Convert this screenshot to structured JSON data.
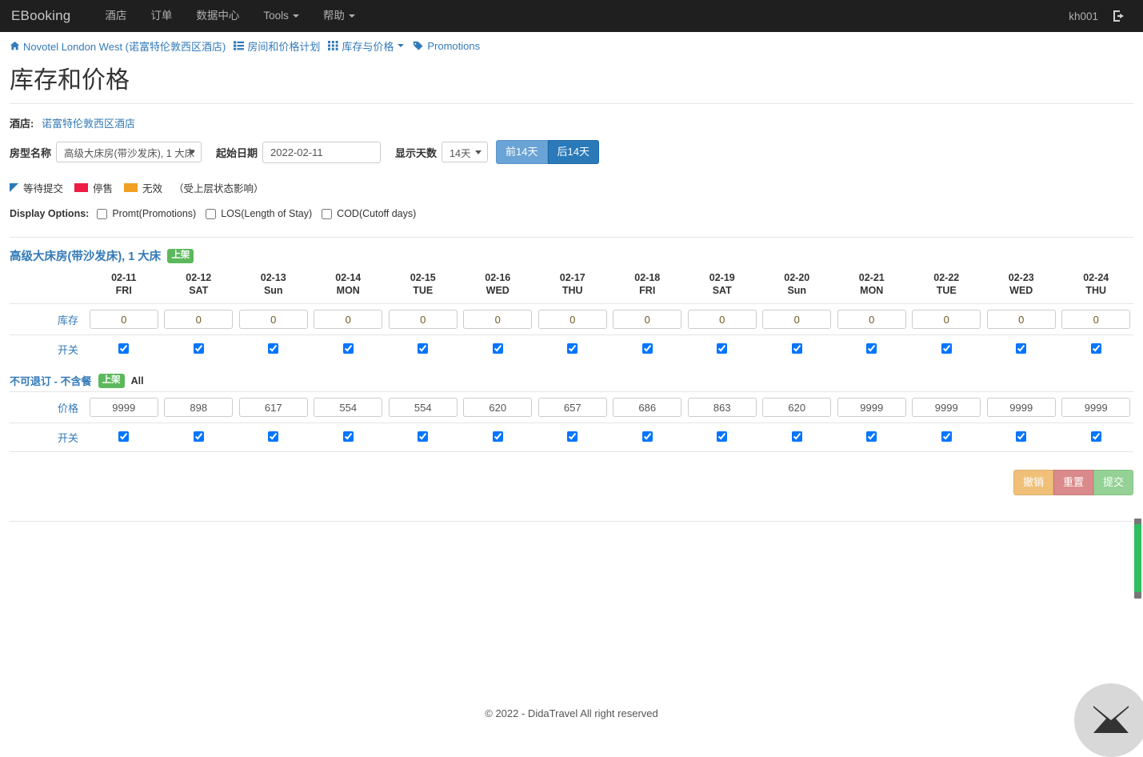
{
  "navbar": {
    "brand": "EBooking",
    "items": [
      {
        "label": "酒店",
        "caret": false
      },
      {
        "label": "订单",
        "caret": false
      },
      {
        "label": "数据中心",
        "caret": false
      },
      {
        "label": "Tools",
        "caret": true
      },
      {
        "label": "帮助",
        "caret": true
      }
    ],
    "user": "kh001",
    "logout_icon": "logout-icon"
  },
  "breadcrumb": {
    "home_icon": "home-icon",
    "hotel": "Novotel London West (诺富特伦敦西区酒店)",
    "list_icon": "list-icon",
    "rooms_plans": "房间和价格计划",
    "grid_icon": "grid-icon",
    "inventory_price": "库存与价格",
    "tag_icon": "tag-icon",
    "promotions": "Promotions"
  },
  "page": {
    "title": "库存和价格",
    "hotel_label": "酒店:",
    "hotel_name": "诺富特伦敦西区酒店"
  },
  "filters": {
    "roomtype_label": "房型名称",
    "roomtype_value": "高级大床房(带沙发床), 1 大床",
    "startdate_label": "起始日期",
    "startdate_value": "2022-02-11",
    "days_label": "显示天数",
    "days_value": "14天",
    "prev_btn": "前14天",
    "next_btn": "后14天"
  },
  "legend": {
    "pending": "等待提交",
    "stopsale": "停售",
    "invalid": "无效",
    "note": "（受上层状态影响）",
    "pending_color": "#2a7ab9",
    "stopsale_color": "#ec1c45",
    "invalid_color": "#f0a025"
  },
  "display_options": {
    "title": "Display Options:",
    "options": [
      {
        "label": "Promt(Promotions)",
        "checked": false
      },
      {
        "label": "LOS(Length of Stay)",
        "checked": false
      },
      {
        "label": "COD(Cutoff days)",
        "checked": false
      }
    ]
  },
  "room": {
    "name": "高级大床房(带沙发床), 1 大床",
    "badge": "上架",
    "inventory_label": "库存",
    "switch_label": "开关"
  },
  "plan": {
    "name": "不可退订 - 不含餐",
    "badge": "上架",
    "all": "All",
    "price_label": "价格",
    "switch_label": "开关"
  },
  "columns": [
    {
      "date": "02-11",
      "dow": "FRI"
    },
    {
      "date": "02-12",
      "dow": "SAT"
    },
    {
      "date": "02-13",
      "dow": "Sun"
    },
    {
      "date": "02-14",
      "dow": "MON"
    },
    {
      "date": "02-15",
      "dow": "TUE"
    },
    {
      "date": "02-16",
      "dow": "WED"
    },
    {
      "date": "02-17",
      "dow": "THU"
    },
    {
      "date": "02-18",
      "dow": "FRI"
    },
    {
      "date": "02-19",
      "dow": "SAT"
    },
    {
      "date": "02-20",
      "dow": "Sun"
    },
    {
      "date": "02-21",
      "dow": "MON"
    },
    {
      "date": "02-22",
      "dow": "TUE"
    },
    {
      "date": "02-23",
      "dow": "WED"
    },
    {
      "date": "02-24",
      "dow": "THU"
    }
  ],
  "inventory_values": [
    "0",
    "0",
    "0",
    "0",
    "0",
    "0",
    "0",
    "0",
    "0",
    "0",
    "0",
    "0",
    "0",
    "0"
  ],
  "inventory_switches": [
    true,
    true,
    true,
    true,
    true,
    true,
    true,
    true,
    true,
    true,
    true,
    true,
    true,
    true
  ],
  "price_values": [
    "9999",
    "898",
    "617",
    "554",
    "554",
    "620",
    "657",
    "686",
    "863",
    "620",
    "9999",
    "9999",
    "9999",
    "9999"
  ],
  "price_switches": [
    true,
    true,
    true,
    true,
    true,
    true,
    true,
    true,
    true,
    true,
    true,
    true,
    true,
    true
  ],
  "actions": {
    "undo": "撤销",
    "reset": "重置",
    "submit": "提交",
    "undo_color": "#f0c078",
    "reset_color": "#da8a8a",
    "submit_color": "#93d194"
  },
  "footer": {
    "copyright": "© 2022 - DidaTravel All right reserved"
  },
  "chat": {
    "icon": "envelope-icon"
  }
}
